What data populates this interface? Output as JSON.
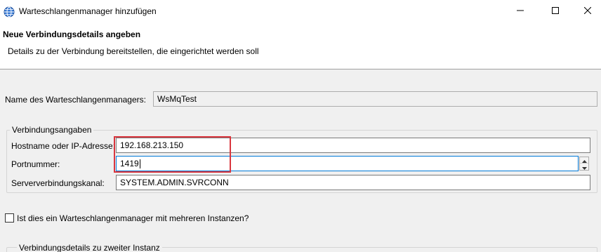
{
  "window": {
    "title": "Warteschlangenmanager hinzufügen",
    "icon": "globe-icon",
    "controls": {
      "minimize": "minimize-icon",
      "maximize": "maximize-icon",
      "close": "close-icon"
    }
  },
  "banner": {
    "title": "Neue Verbindungsdetails angeben",
    "description": "Details zu der Verbindung bereitstellen, die eingerichtet werden soll"
  },
  "qmgr": {
    "label": "Name des Warteschlangenmanagers:",
    "value": "WsMqTest"
  },
  "connection": {
    "legend": "Verbindungsangaben",
    "hostname_label": "Hostname oder IP-Adresse:",
    "hostname_value": "192.168.213.150",
    "port_label": "Portnummer:",
    "port_value": "1419",
    "channel_label": "Serververbindungskanal:",
    "channel_value": "SYSTEM.ADMIN.SVRCONN"
  },
  "multi_instance": {
    "label": "Ist dies ein Warteschlangenmanager mit mehreren Instanzen?",
    "checked": false
  },
  "second_instance": {
    "legend": "Verbindungsdetails zu zweiter Instanz"
  },
  "colors": {
    "highlight": "#d9363e",
    "focus_border": "#0078d7"
  }
}
